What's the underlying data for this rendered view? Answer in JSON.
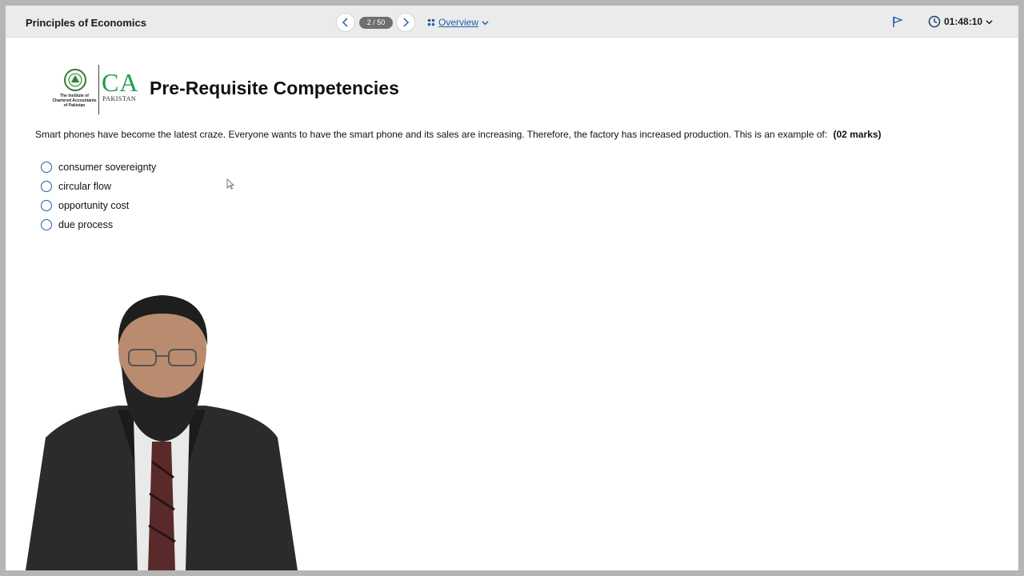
{
  "app": {
    "title": "Principles of Economics"
  },
  "nav": {
    "counter": "2 / 50",
    "overview_label": "Overview",
    "timer": "01:48:10"
  },
  "logo": {
    "org_text": "CA",
    "org_sub": "PAKISTAN",
    "seal_caption": "The Institute of Chartered Accountants of Pakistan"
  },
  "page": {
    "title": "Pre-Requisite Competencies"
  },
  "question": {
    "text": "Smart phones have become the latest craze. Everyone wants to have the smart phone and its sales are increasing. Therefore, the factory has increased production. This is an example of:",
    "marks": "(02 marks)",
    "options": [
      {
        "label": "consumer sovereignty"
      },
      {
        "label": "circular flow"
      },
      {
        "label": "opportunity cost"
      },
      {
        "label": "due process"
      }
    ]
  },
  "colors": {
    "accent": "#1f5fa6",
    "brand_green": "#1c9e4b",
    "topbar": "#ebebeb"
  },
  "icons": [
    "chevron-left-icon",
    "chevron-right-icon",
    "grid-icon",
    "chevron-down-icon",
    "flag-icon",
    "clock-icon",
    "cursor-icon"
  ]
}
